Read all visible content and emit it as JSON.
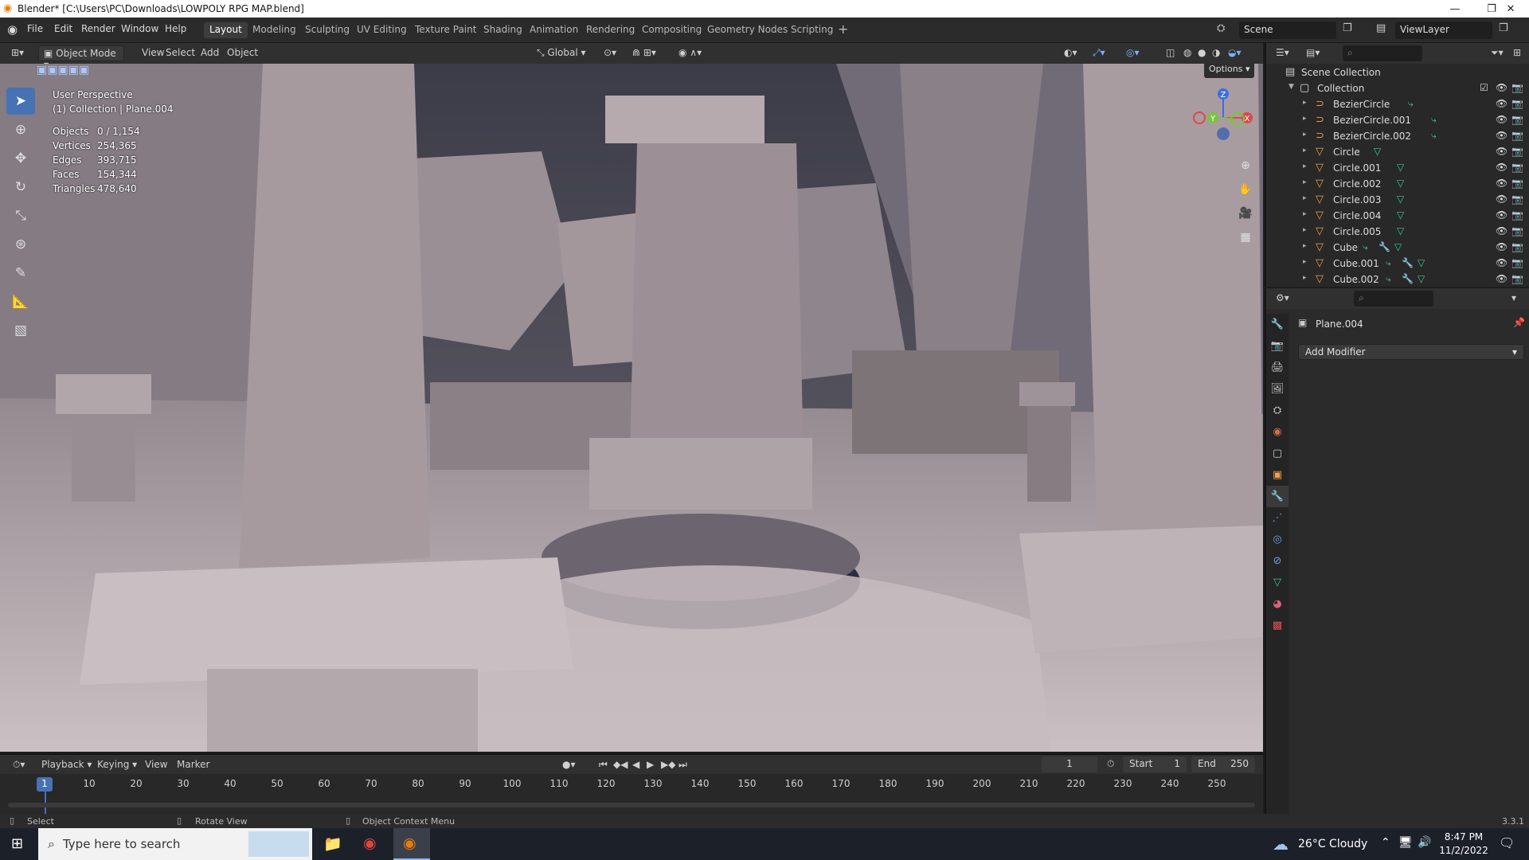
{
  "window": {
    "title": "Blender* [C:\\Users\\PC\\Downloads\\LOWPOLY RPG MAP.blend]"
  },
  "menu": [
    "File",
    "Edit",
    "Render",
    "Window",
    "Help"
  ],
  "workspaces": [
    "Layout",
    "Modeling",
    "Sculpting",
    "UV Editing",
    "Texture Paint",
    "Shading",
    "Animation",
    "Rendering",
    "Compositing",
    "Geometry Nodes",
    "Scripting"
  ],
  "active_workspace": "Layout",
  "scene": "Scene",
  "view_layer": "ViewLayer",
  "header3d": {
    "mode": "Object Mode",
    "menus": [
      "View",
      "Select",
      "Add",
      "Object"
    ],
    "orientation": "Global",
    "options": "Options"
  },
  "viewport": {
    "perspective": "User Perspective",
    "collection": "(1) Collection | Plane.004",
    "stats": [
      {
        "k": "Objects",
        "v": "0 / 1,154"
      },
      {
        "k": "Vertices",
        "v": "254,365"
      },
      {
        "k": "Edges",
        "v": "393,715"
      },
      {
        "k": "Faces",
        "v": "154,344"
      },
      {
        "k": "Triangles",
        "v": "478,640"
      }
    ],
    "gizmo_axes": {
      "z": "Z",
      "y": "Y",
      "x": "X"
    }
  },
  "outliner": {
    "root": "Scene Collection",
    "collection": "Collection",
    "items": [
      "BezierCircle",
      "BezierCircle.001",
      "BezierCircle.002",
      "Circle",
      "Circle.001",
      "Circle.002",
      "Circle.003",
      "Circle.004",
      "Circle.005",
      "Cube",
      "Cube.001",
      "Cube.002"
    ]
  },
  "properties": {
    "object": "Plane.004",
    "add_modifier": "Add Modifier"
  },
  "timeline": {
    "menus": [
      "Playback",
      "Keying",
      "View",
      "Marker"
    ],
    "current_frame": "1",
    "start_label": "Start",
    "start": "1",
    "end_label": "End",
    "end": "250",
    "ticks": [
      "10",
      "20",
      "30",
      "40",
      "50",
      "60",
      "70",
      "80",
      "90",
      "100",
      "110",
      "120",
      "130",
      "140",
      "150",
      "160",
      "170",
      "180",
      "190",
      "200",
      "210",
      "220",
      "230",
      "240",
      "250"
    ]
  },
  "statusbar": {
    "select": "Select",
    "rotate": "Rotate View",
    "context": "Object Context Menu",
    "version": "3.3.1"
  },
  "taskbar": {
    "search_placeholder": "Type here to search",
    "weather": "26°C  Cloudy",
    "time": "8:47 PM",
    "date": "11/2/2022"
  }
}
